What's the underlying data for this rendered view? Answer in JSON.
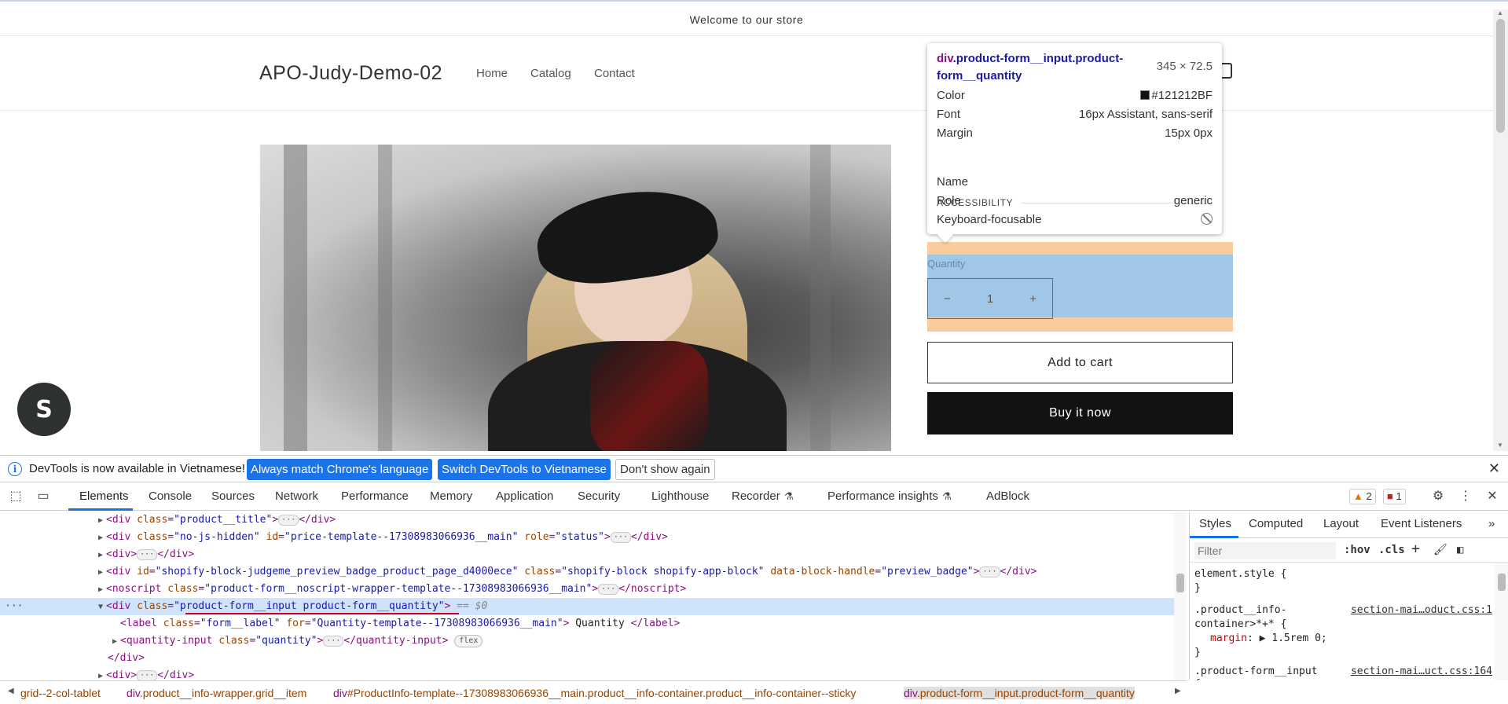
{
  "page": {
    "announcement": "Welcome to our store",
    "logo": "APO-Judy-Demo-02",
    "nav": [
      "Home",
      "Catalog",
      "Contact"
    ],
    "quantity_label": "Quantity",
    "quantity_value": "1",
    "minus": "−",
    "plus": "+",
    "add_to_cart": "Add to cart",
    "buy_now": "Buy it now",
    "shopify_badge_letter": "S"
  },
  "tooltip": {
    "tag": "div",
    "classes": ".product-form__input.product-form__quantity",
    "size": "345 × 72.5",
    "color_label": "Color",
    "color_value": "#121212BF",
    "font_label": "Font",
    "font_value": "16px Assistant, sans-serif",
    "margin_label": "Margin",
    "margin_value": "15px 0px",
    "accessibility_heading": "ACCESSIBILITY",
    "name_label": "Name",
    "name_value": "",
    "role_label": "Role",
    "role_value": "generic",
    "focusable_label": "Keyboard-focusable"
  },
  "infobar": {
    "message": "DevTools is now available in Vietnamese!",
    "btn_match": "Always match Chrome's language",
    "btn_switch": "Switch DevTools to Vietnamese",
    "btn_dismiss": "Don't show again",
    "close": "✕"
  },
  "devtools": {
    "tabs": [
      "Elements",
      "Console",
      "Sources",
      "Network",
      "Performance",
      "Memory",
      "Application",
      "Security",
      "Lighthouse",
      "Recorder",
      "Performance insights",
      "AdBlock"
    ],
    "active_tab": "Elements",
    "warnings": "2",
    "issues": "1"
  },
  "dom": {
    "line1": {
      "tag": "div",
      "attr": "class",
      "val": "\"product__title\""
    },
    "line2": {
      "tag": "div",
      "a1": "class",
      "v1": "\"no-js-hidden\"",
      "a2": "id",
      "v2": "\"price-template--17308983066936__main\"",
      "a3": "role",
      "v3": "\"status\""
    },
    "line3": {
      "tag": "div"
    },
    "line4": {
      "tag": "div",
      "a1": "id",
      "v1": "\"shopify-block-judgeme_preview_badge_product_page_d4000ece\"",
      "a2": "class",
      "v2": "\"shopify-block shopify-app-block\"",
      "a3": "data-block-handle",
      "v3": "\"preview_badge\""
    },
    "line5": {
      "tag": "noscript",
      "attr": "class",
      "val": "\"product-form__noscript-wrapper-template--17308983066936__main\""
    },
    "line6": {
      "tag": "div",
      "attr": "class",
      "val": "\"product-form__input product-form__quantity\"",
      "suffix": "== $0"
    },
    "line7": {
      "tag": "label",
      "a1": "class",
      "v1": "\"form__label\"",
      "a2": "for",
      "v2": "\"Quantity-template--17308983066936__main\"",
      "text": "Quantity"
    },
    "line8": {
      "tag": "quantity-input",
      "attr": "class",
      "val": "\"quantity\"",
      "badge": "flex"
    },
    "line9": {
      "close": "</div>"
    },
    "line10": {
      "tag": "div"
    },
    "dots": "···"
  },
  "styles": {
    "tabs": [
      "Styles",
      "Computed",
      "Layout",
      "Event Listeners"
    ],
    "filter_placeholder": "Filter",
    "hov": ":hov",
    "cls": ".cls",
    "element_style": "element.style {",
    "close_brace": "}",
    "rule1_selector_a": ".product__info-",
    "rule1_selector_b": "container>*+* {",
    "rule1_src": "section-mai…oduct.css:1",
    "rule1_prop": "margin",
    "rule1_value": "1.5rem 0;",
    "rule2_selector": ".product-form__input",
    "rule2_src": "section-mai…uct.css:164",
    "rule2_open": "{"
  },
  "breadcrumb": [
    {
      "tag": "",
      "cls": "grid--2-col-tablet"
    },
    {
      "tag": "div",
      "cls": ".product__info-wrapper.grid__item"
    },
    {
      "tag": "div",
      "cls": "#ProductInfo-template--17308983066936__main.product__info-container.product__info-container--sticky"
    },
    {
      "tag": "div",
      "cls": ".product-form__input.product-form__quantity"
    }
  ]
}
